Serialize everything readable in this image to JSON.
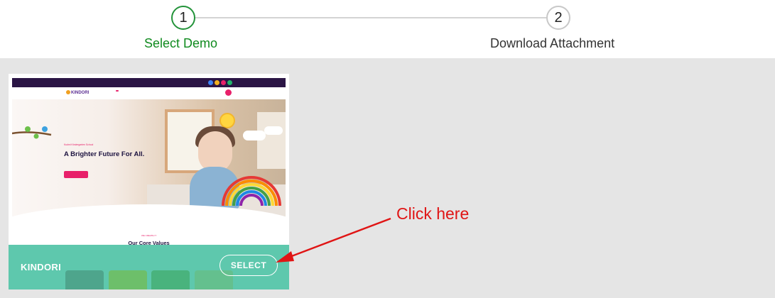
{
  "stepper": {
    "steps": [
      {
        "number": "1",
        "label": "Select Demo",
        "state": "active"
      },
      {
        "number": "2",
        "label": "Download Attachment",
        "state": "pending"
      }
    ],
    "colors": {
      "active": "#0f8a1e",
      "ring_active": "#23933a",
      "ring_pending": "#c8c8c8",
      "line": "#d4d4d4"
    }
  },
  "demo_card": {
    "name": "KINDORI",
    "select_label": "SELECT",
    "overlay_color": "#52c4a7",
    "preview": {
      "brand": "KINDORI",
      "hero_tag": "Kudmi Kindergarten School",
      "hero_title": "A Brighter Future For All.",
      "section_tag": "WE CREATE IT",
      "section_title": "Our Core Values"
    }
  },
  "annotation": {
    "text": "Click here",
    "color": "#e01515"
  }
}
